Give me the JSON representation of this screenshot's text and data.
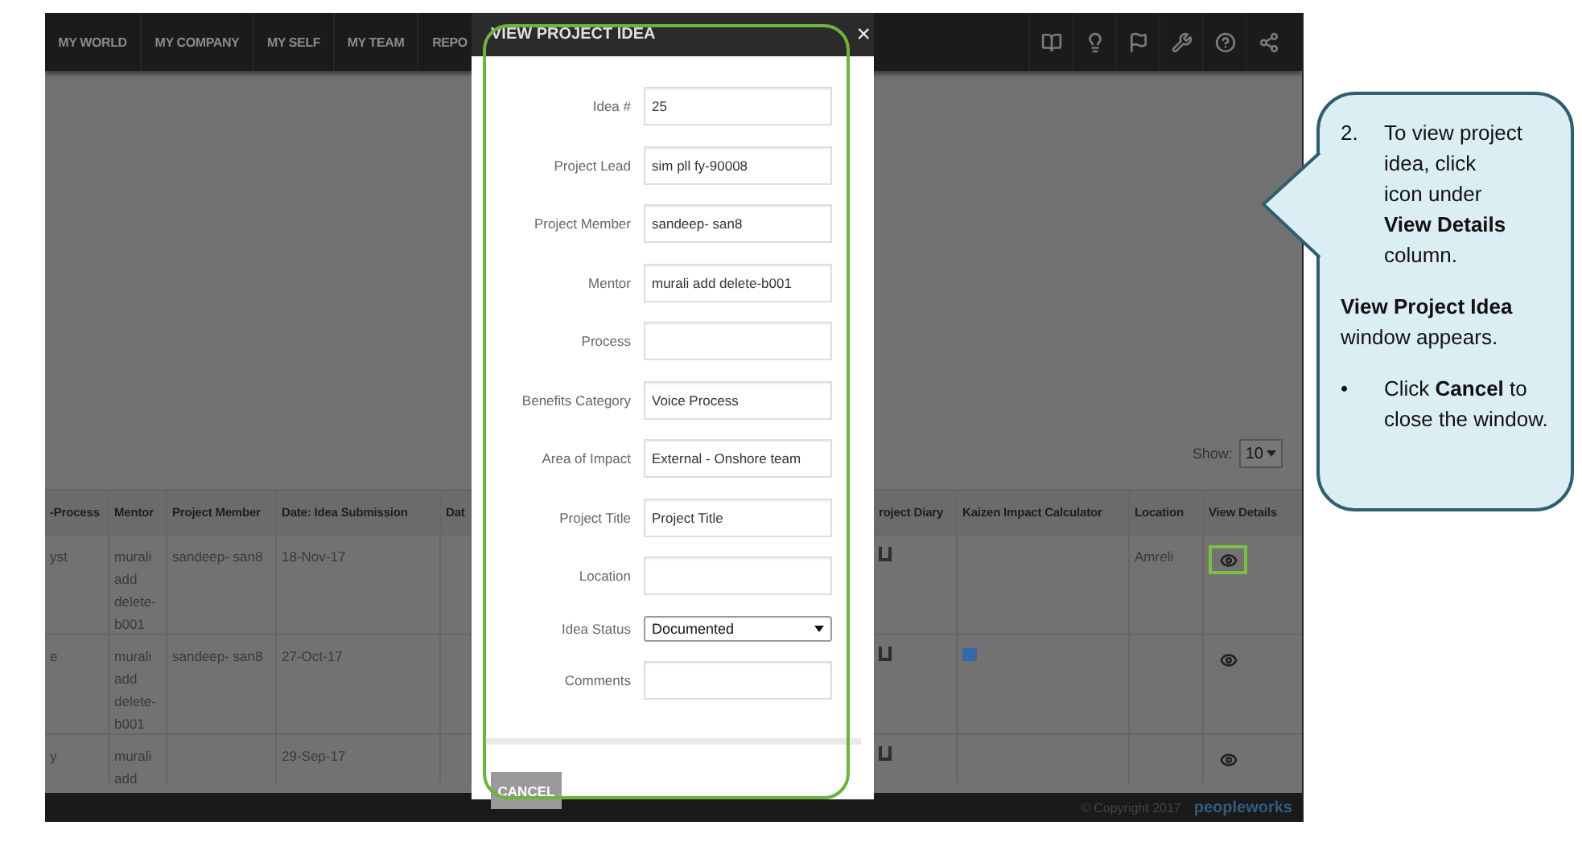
{
  "navbar": {
    "items": [
      {
        "label": "MY WORLD"
      },
      {
        "label": "MY COMPANY"
      },
      {
        "label": "MY SELF"
      },
      {
        "label": "MY TEAM"
      },
      {
        "label": "REPO"
      }
    ]
  },
  "table": {
    "show": {
      "label": "Show:",
      "value": "10"
    },
    "columns": [
      "-Process",
      "Mentor",
      "Project Member",
      "Date: Idea Submission",
      "Dat",
      "roject Diary",
      "Kaizen Impact Calculator",
      "Location",
      "View Details"
    ],
    "rows": [
      {
        "process": "yst",
        "mentor": "murali add delete-b001",
        "project_member": "sandeep- san8",
        "date": "18-Nov-17",
        "kaizen": false,
        "location": "Amreli",
        "highlighted": true
      },
      {
        "process": "e",
        "mentor": "murali add delete-b001",
        "project_member": "sandeep- san8",
        "date": "27-Oct-17",
        "kaizen": true,
        "highlighted": false
      },
      {
        "process": "y",
        "mentor": "murali add",
        "date": "29-Sep-17",
        "kaizen": false,
        "highlighted": false
      }
    ]
  },
  "footer": {
    "copyright": "© Copyright 2017",
    "logo": "peopleworks"
  },
  "modal": {
    "title": "VIEW PROJECT IDEA",
    "close": "×",
    "fields": [
      {
        "label": "Idea #",
        "kind": "text",
        "value": "25"
      },
      {
        "label": "Project Lead",
        "kind": "text",
        "value": "sim pll fy-90008"
      },
      {
        "label": "Project Member",
        "kind": "text",
        "value": "sandeep- san8"
      },
      {
        "label": "Mentor",
        "kind": "text",
        "value": "murali add delete-b001"
      },
      {
        "label": "Process",
        "kind": "text"
      },
      {
        "label": "Benefits Category",
        "kind": "text",
        "value": "Voice Process"
      },
      {
        "label": "Area of Impact",
        "kind": "text",
        "value": "External - Onshore team"
      },
      {
        "label": "Project Title",
        "kind": "text",
        "value": "Project Title"
      },
      {
        "label": "Location",
        "kind": "text"
      },
      {
        "label": "Idea Status",
        "kind": "select",
        "value": "Documented"
      },
      {
        "label": "Comments",
        "kind": "text"
      }
    ],
    "cancel_button": "CANCEL"
  },
  "callout": {
    "step_number": "2.",
    "step_text_before": "To view project idea, click",
    "step_text_after": "icon under **View Details** column.",
    "note": "**View Project Idea** window appears.",
    "bullets": [
      {
        "marker": "•",
        "text": "Click **Cancel** to close the window."
      }
    ]
  }
}
